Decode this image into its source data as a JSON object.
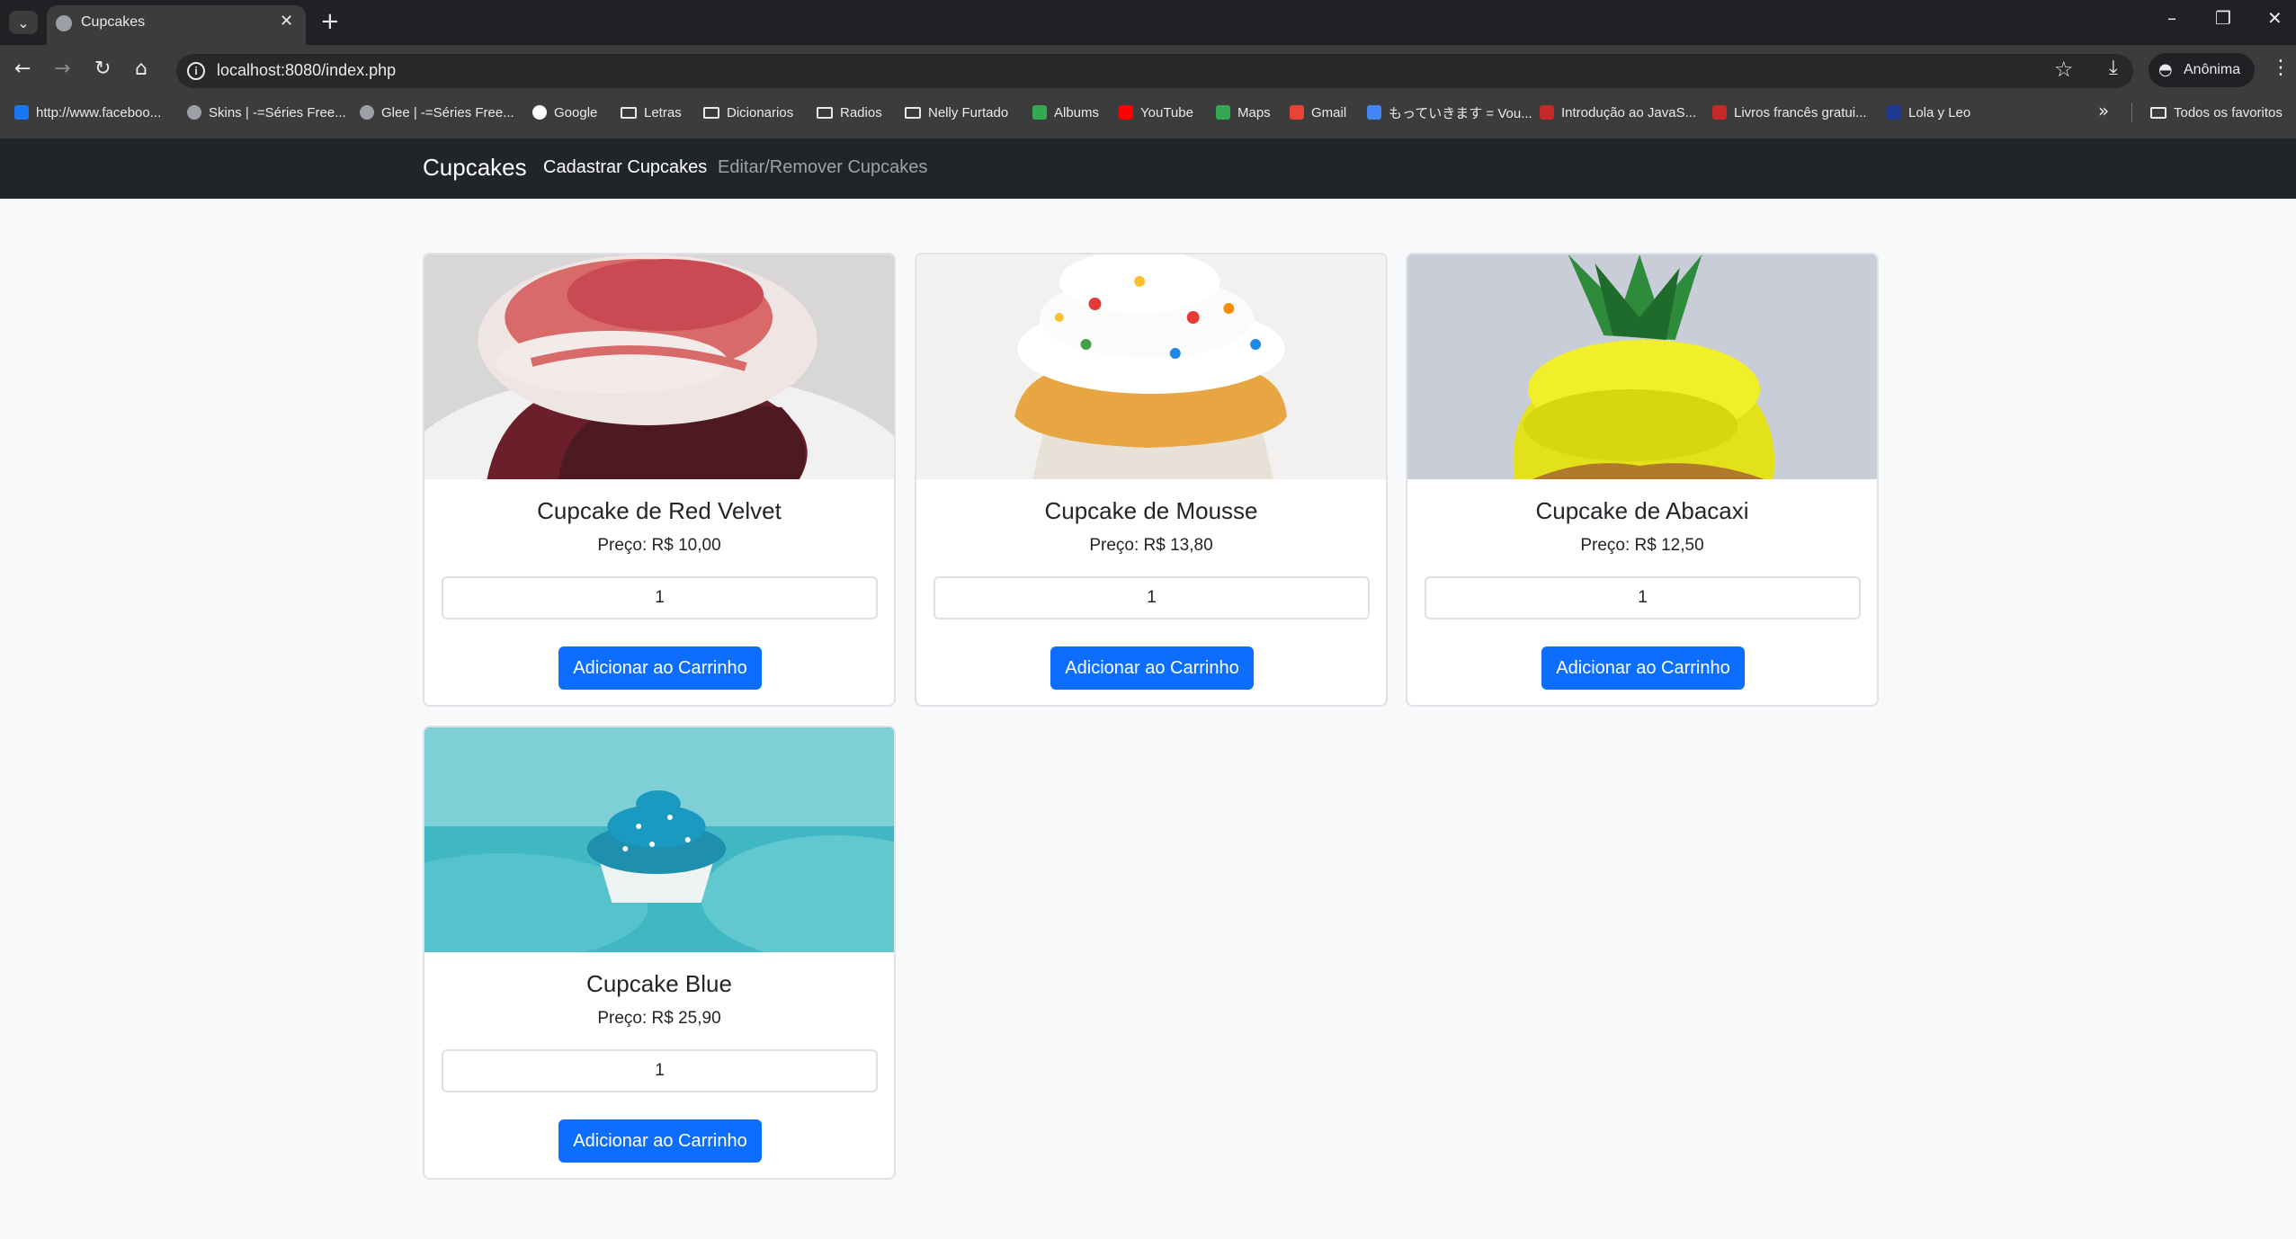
{
  "browser": {
    "tab_title": "Cupcakes",
    "url": "localhost:8080/index.php",
    "incognito_label": "Anônima",
    "bookmarks": [
      {
        "label": "http://www.faceboo...",
        "icon": "facebook-icon"
      },
      {
        "label": "Skins | -=Séries Free...",
        "icon": "globe-icon"
      },
      {
        "label": "Glee | -=Séries Free...",
        "icon": "globe-icon"
      },
      {
        "label": "Google",
        "icon": "google-icon"
      },
      {
        "label": "Letras",
        "icon": "folder-icon"
      },
      {
        "label": "Dicionarios",
        "icon": "folder-icon"
      },
      {
        "label": "Radios",
        "icon": "folder-icon"
      },
      {
        "label": "Nelly Furtado",
        "icon": "folder-icon"
      },
      {
        "label": "Albums",
        "icon": "drive-icon"
      },
      {
        "label": "YouTube",
        "icon": "youtube-icon"
      },
      {
        "label": "Maps",
        "icon": "maps-icon"
      },
      {
        "label": "Gmail",
        "icon": "gmail-icon"
      },
      {
        "label": "もっていきます = Vou...",
        "icon": "docs-icon"
      },
      {
        "label": "Introdução ao JavaS...",
        "icon": "site-icon"
      },
      {
        "label": "Livros francês gratui...",
        "icon": "site-icon"
      },
      {
        "label": "Lola y Leo",
        "icon": "uk-flag-icon"
      }
    ],
    "all_bookmarks": "Todos os favoritos"
  },
  "navbar": {
    "brand": "Cupcakes",
    "links": [
      "Cadastrar Cupcakes",
      "Editar/Remover Cupcakes"
    ]
  },
  "products": [
    {
      "name": "Cupcake de Red Velvet",
      "price": "Preço: R$ 10,00",
      "quantity": "1",
      "button": "Adicionar ao Carrinho",
      "image": "red-velvet-cupcake-image"
    },
    {
      "name": "Cupcake de Mousse",
      "price": "Preço: R$ 13,80",
      "quantity": "1",
      "button": "Adicionar ao Carrinho",
      "image": "mousse-cupcake-image"
    },
    {
      "name": "Cupcake de Abacaxi",
      "price": "Preço: R$ 12,50",
      "quantity": "1",
      "button": "Adicionar ao Carrinho",
      "image": "pineapple-cupcake-image"
    },
    {
      "name": "Cupcake Blue",
      "price": "Preço: R$ 25,90",
      "quantity": "1",
      "button": "Adicionar ao Carrinho",
      "image": "blue-cupcake-image"
    }
  ],
  "colors": {
    "navbar": "#212529",
    "primary_button": "#0d6efd",
    "page_background": "#f8f9fa"
  }
}
